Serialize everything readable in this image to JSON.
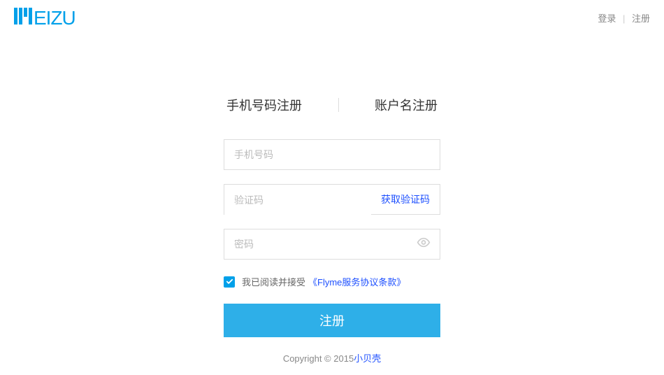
{
  "header": {
    "login_label": "登录",
    "register_label": "注册"
  },
  "tabs": {
    "phone_register": "手机号码注册",
    "username_register": "账户名注册"
  },
  "form": {
    "phone_placeholder": "手机号码",
    "verify_placeholder": "验证码",
    "verify_button": "获取验证码",
    "password_placeholder": "密码"
  },
  "agreement": {
    "text": "我已阅读并接受",
    "link": "《Flyme服务协议条款》"
  },
  "submit_label": "注册",
  "copyright": {
    "prefix": "Copyright © 2015",
    "link": "小贝壳"
  }
}
